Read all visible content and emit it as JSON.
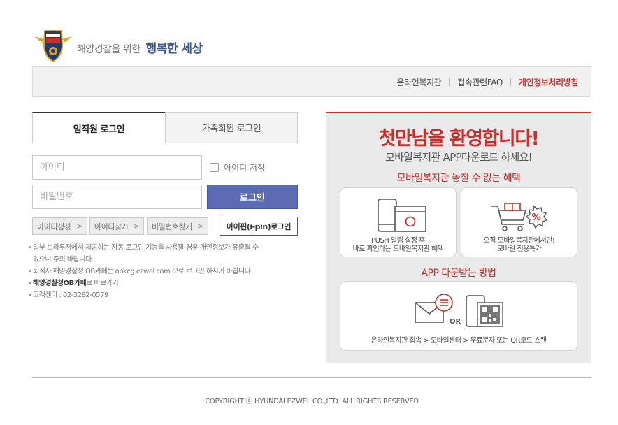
{
  "header": {
    "tagline_prefix": "해양경찰을 위한",
    "tagline_main": "행복한 세상",
    "logo_text": "POLICE 해양경찰"
  },
  "topnav": {
    "items": [
      "온라인복지관",
      "접속관련FAQ",
      "개인정보처리방침"
    ]
  },
  "login": {
    "tabs": [
      "임직원 로그인",
      "가족회원 로그인"
    ],
    "id_placeholder": "아이디",
    "pw_placeholder": "비밀번호",
    "save_id_label": "아이디 저장",
    "login_label": "로그인",
    "signup_label": "아이디생성",
    "find_id_label": "아이디찾기",
    "find_pw_label": "비밀번호찾기",
    "ipin_label": "아이핀(i-pin)로그인",
    "notes": [
      "일부 브라우저에서 제공하는 자동 로그인 기능을 사용할 경우 개인정보가 유출될 수",
      "있으니 주의 바랍니다.",
      "퇴직자 해양경찰청 OB카페는 obkcg.ezwel.com 으로 로그인 하시기 바랍니다.",
      "해양경찰청OB카페",
      "로 바로가기",
      "고객센터 : 02-3282-0579"
    ]
  },
  "promo": {
    "title": "첫만남을 환영합니다!",
    "subtitle": "모바일복지관 APP다운로드 하세요!",
    "benefits_heading": "모바일복지관 놓칠 수 없는 혜택",
    "card1_line1": "PUSH 알림 설정 후",
    "card1_line2": "바로 확인하는 모바일복지관 혜택",
    "card2_line1": "오직 모바일복지관에서만!",
    "card2_line2": "모바일 전용특가",
    "download_heading": "APP 다운받는 방법",
    "or_label": "OR",
    "download_steps": "온라인복지관 접속 > 모바일센터 > 무료문자 또는 QR코드 스캔"
  },
  "footer": {
    "copyright": "COPYRIGHT ⓒ HYUNDAI EZWEL CO.,LTD. ALL RIGHTS RESERVED"
  },
  "colors": {
    "accent_red": "#cc2d2a",
    "login_blue": "#5b6cb4",
    "brand_blue": "#3d5b9a"
  }
}
